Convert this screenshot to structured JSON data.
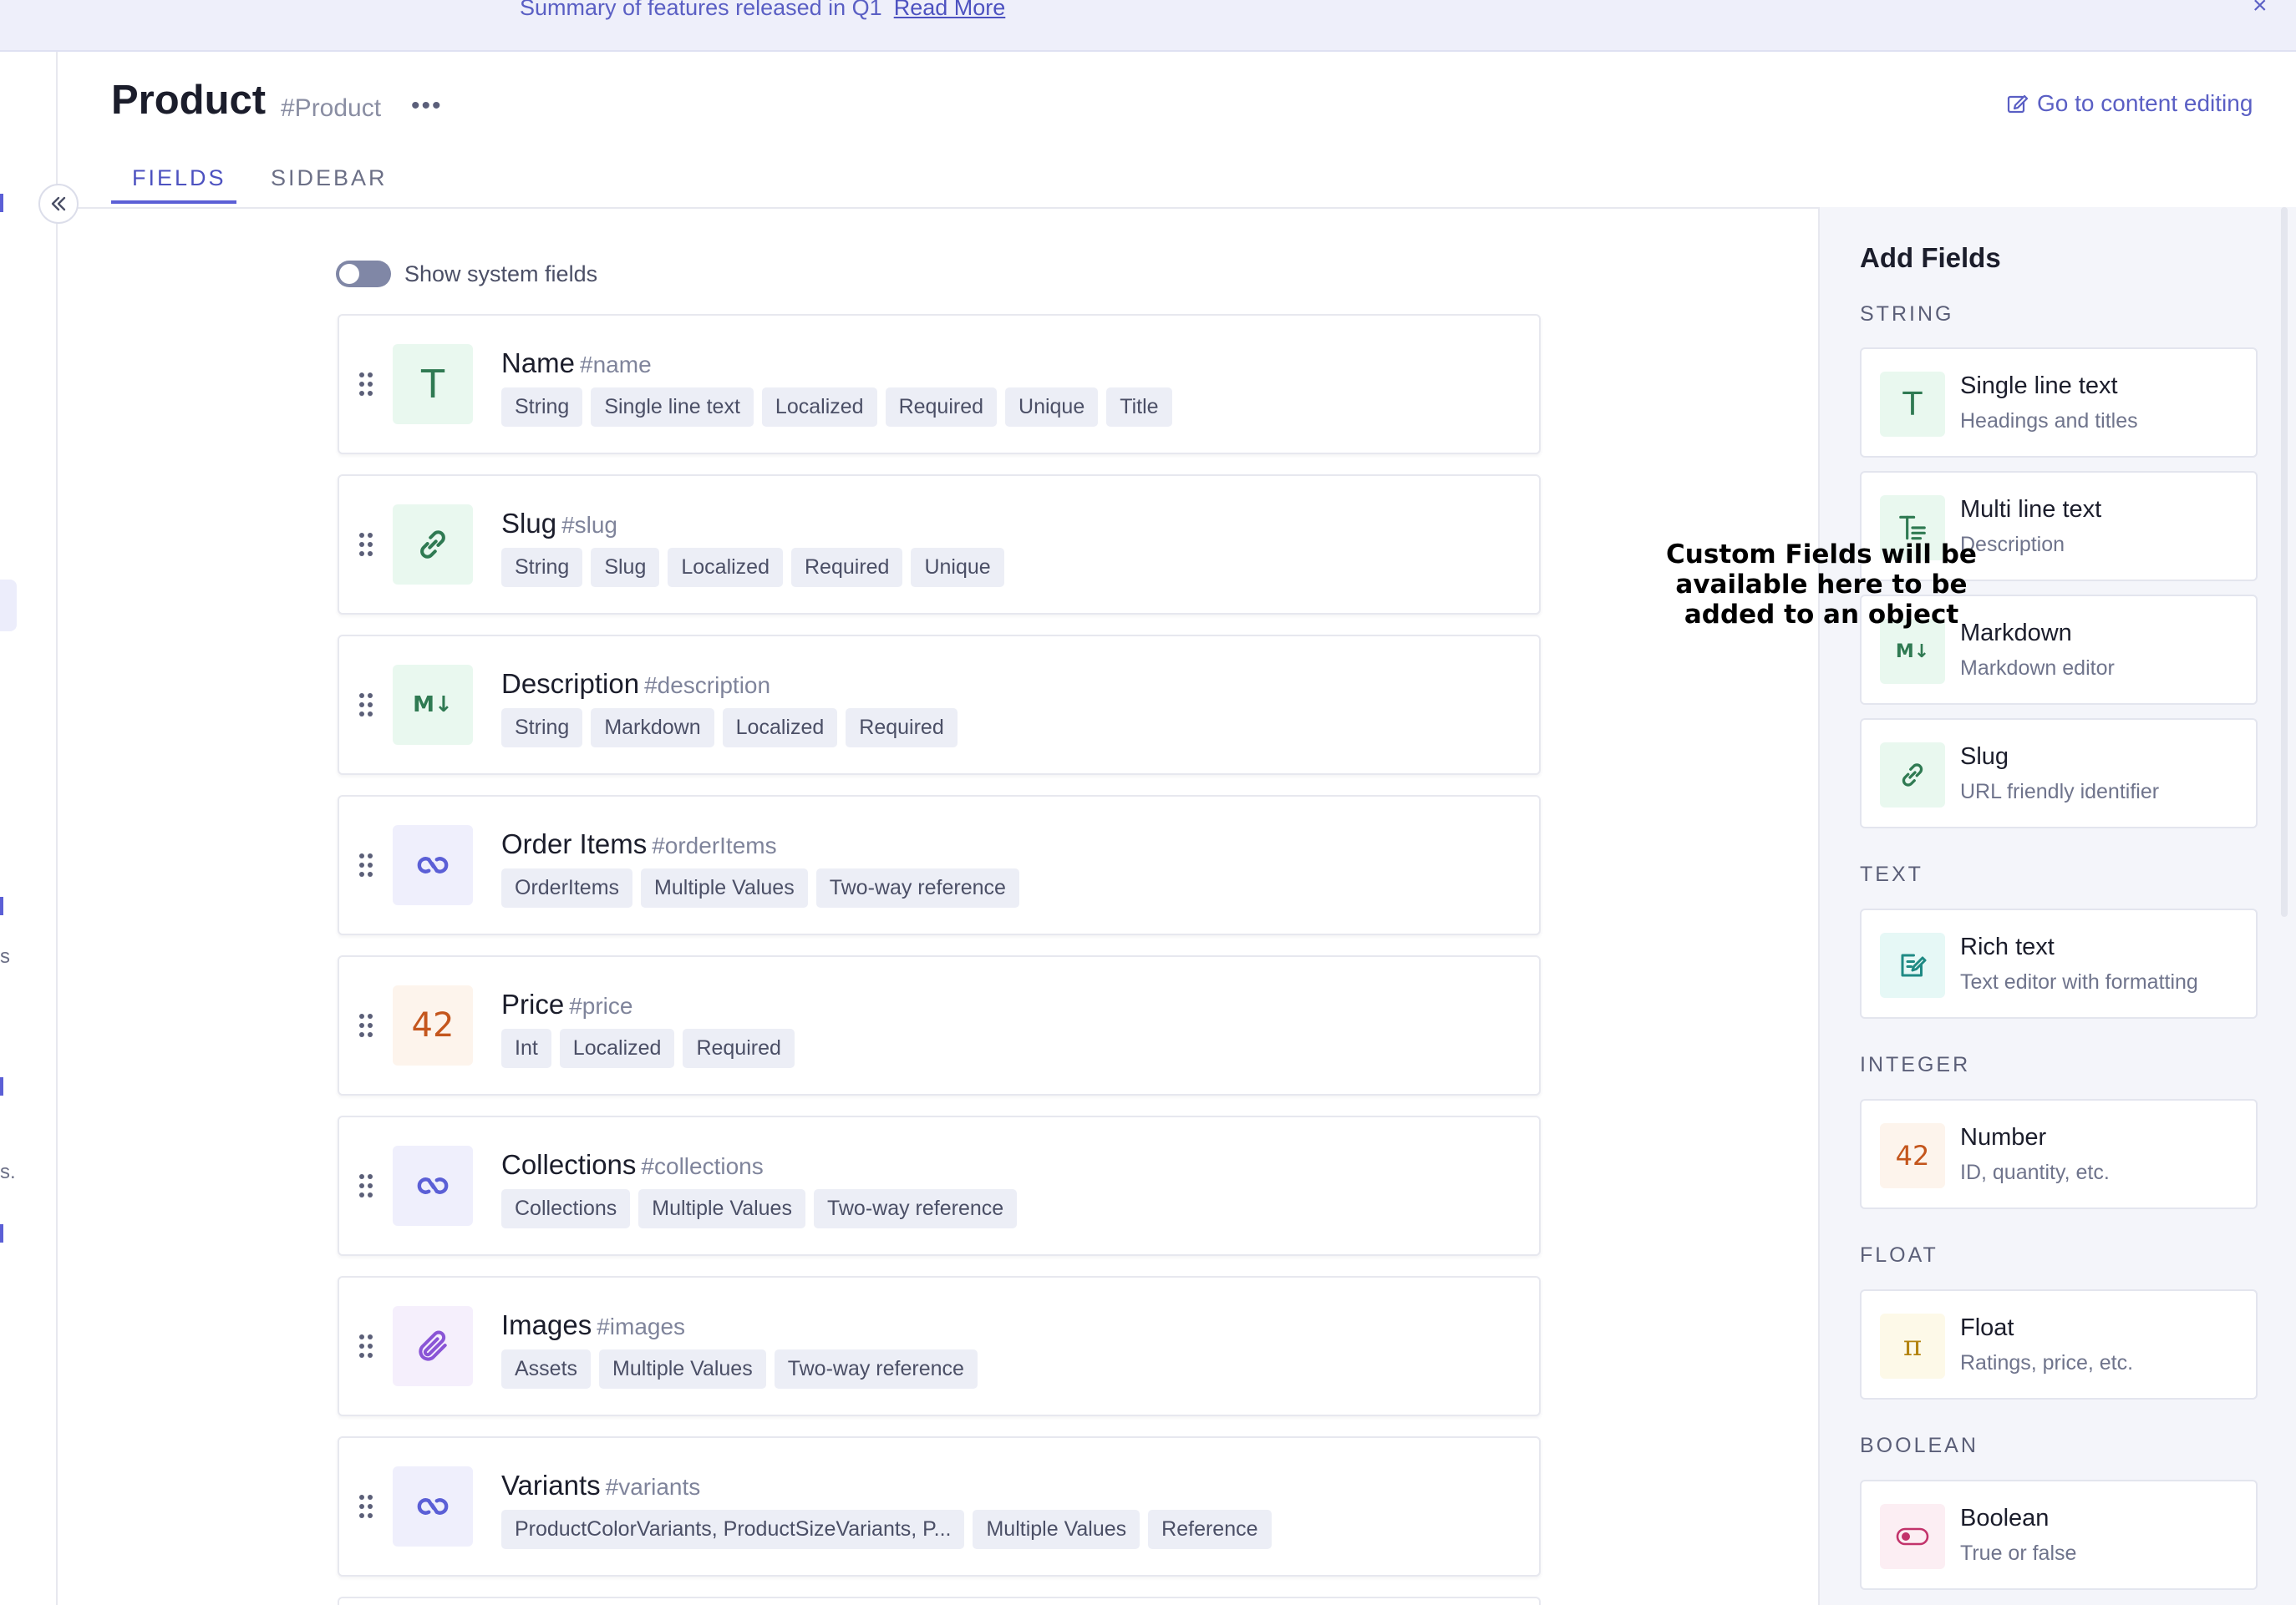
{
  "banner": {
    "text": "Summary of features released in Q1",
    "link": "Read More",
    "close": "×"
  },
  "left_rail": {
    "fragments": [
      "s",
      "s."
    ]
  },
  "header": {
    "title": "Product",
    "api_id": "#Product",
    "more": "•••",
    "goto_label": "Go to content editing"
  },
  "tabs": [
    {
      "label": "FIELDS",
      "active": true
    },
    {
      "label": "SIDEBAR",
      "active": false
    }
  ],
  "toggle": {
    "label": "Show system fields",
    "on": false
  },
  "fields": [
    {
      "name": "Name",
      "api": "#name",
      "icon": "text-icon",
      "glyph": "T",
      "tags": [
        "String",
        "Single line text",
        "Localized",
        "Required",
        "Unique",
        "Title"
      ]
    },
    {
      "name": "Slug",
      "api": "#slug",
      "icon": "link-icon",
      "tags": [
        "String",
        "Slug",
        "Localized",
        "Required",
        "Unique"
      ]
    },
    {
      "name": "Description",
      "api": "#description",
      "icon": "markdown-icon",
      "glyph": "M↓",
      "tags": [
        "String",
        "Markdown",
        "Localized",
        "Required"
      ]
    },
    {
      "name": "Order Items",
      "api": "#orderItems",
      "icon": "reference-icon",
      "tags": [
        "OrderItems",
        "Multiple Values",
        "Two-way reference"
      ]
    },
    {
      "name": "Price",
      "api": "#price",
      "icon": "integer-icon",
      "glyph": "42",
      "tags": [
        "Int",
        "Localized",
        "Required"
      ]
    },
    {
      "name": "Collections",
      "api": "#collections",
      "icon": "reference-icon",
      "tags": [
        "Collections",
        "Multiple Values",
        "Two-way reference"
      ]
    },
    {
      "name": "Images",
      "api": "#images",
      "icon": "paperclip-icon",
      "tags": [
        "Assets",
        "Multiple Values",
        "Two-way reference"
      ]
    },
    {
      "name": "Variants",
      "api": "#variants",
      "icon": "reference-icon",
      "tags": [
        "ProductColorVariants, ProductSizeVariants, P...",
        "Multiple Values",
        "Reference"
      ]
    }
  ],
  "add_fields": {
    "title": "Add Fields",
    "sections": [
      {
        "label": "STRING",
        "items": [
          {
            "title": "Single line text",
            "subtitle": "Headings and titles",
            "icon": "text-icon",
            "glyph": "T"
          },
          {
            "title": "Multi line text",
            "subtitle": "Description",
            "icon": "multiline-text-icon"
          },
          {
            "title": "Markdown",
            "subtitle": "Markdown editor",
            "icon": "markdown-icon",
            "glyph": "M↓"
          },
          {
            "title": "Slug",
            "subtitle": "URL friendly identifier",
            "icon": "link-icon"
          }
        ]
      },
      {
        "label": "TEXT",
        "items": [
          {
            "title": "Rich text",
            "subtitle": "Text editor with formatting",
            "icon": "rich-text-icon"
          }
        ]
      },
      {
        "label": "INTEGER",
        "items": [
          {
            "title": "Number",
            "subtitle": "ID, quantity, etc.",
            "icon": "integer-icon",
            "glyph": "42"
          }
        ]
      },
      {
        "label": "FLOAT",
        "items": [
          {
            "title": "Float",
            "subtitle": "Ratings, price, etc.",
            "icon": "float-icon",
            "glyph": "π"
          }
        ]
      },
      {
        "label": "BOOLEAN",
        "items": [
          {
            "title": "Boolean",
            "subtitle": "True or false",
            "icon": "boolean-icon"
          }
        ]
      }
    ]
  },
  "annotation": "Custom Fields will be available here to be added to an object",
  "colors": {
    "accent": "#5b5fd6",
    "string_icon_bg": "#e9f8ef",
    "string_icon_fg": "#2f7a52",
    "reference_icon_bg": "#efeffc",
    "reference_icon_fg": "#5b5fd6",
    "integer_icon_bg": "#fdf4ec",
    "integer_icon_fg": "#c4561d",
    "asset_icon_bg": "#f5effc",
    "asset_icon_fg": "#8a55d6",
    "rich_text_icon_bg": "#e6f8f6",
    "rich_text_icon_fg": "#1f8a84",
    "float_icon_bg": "#fdf9e8",
    "float_icon_fg": "#b3830f",
    "boolean_icon_bg": "#fceef3",
    "boolean_icon_fg": "#c2336b"
  }
}
